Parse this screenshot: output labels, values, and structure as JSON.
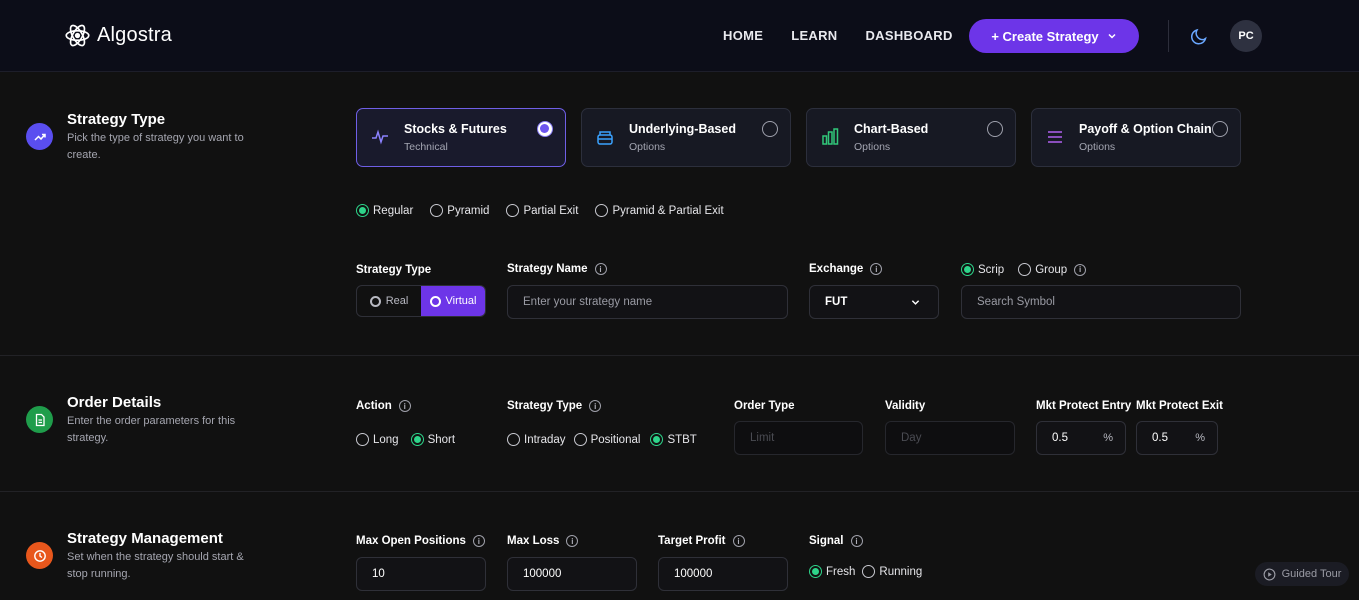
{
  "header": {
    "brand": "Algostra",
    "nav": [
      {
        "label": "HOME"
      },
      {
        "label": "LEARN"
      },
      {
        "label": "DASHBOARD"
      }
    ],
    "create_label": "+ Create Strategy",
    "avatar": "PC"
  },
  "strategy_type_section": {
    "title": "Strategy Type",
    "desc": "Pick the type of strategy you want to create.",
    "cards": [
      {
        "title": "Stocks & Futures",
        "sub": "Technical",
        "selected": true
      },
      {
        "title": "Underlying-Based",
        "sub": "Options",
        "selected": false
      },
      {
        "title": "Chart-Based",
        "sub": "Options",
        "selected": false
      },
      {
        "title": "Payoff & Option Chain",
        "sub": "Options",
        "selected": false
      }
    ],
    "modes": [
      {
        "label": "Regular",
        "selected": true
      },
      {
        "label": "Pyramid",
        "selected": false
      },
      {
        "label": "Partial Exit",
        "selected": false
      },
      {
        "label": "Pyramid & Partial Exit",
        "selected": false
      }
    ],
    "strategy_type_label": "Strategy Type",
    "toggle": {
      "real": "Real",
      "virtual": "Virtual",
      "active": "Virtual"
    },
    "strategy_name_label": "Strategy Name",
    "strategy_name_placeholder": "Enter your strategy name",
    "exchange_label": "Exchange",
    "exchange_value": "FUT",
    "scrip_label": "Scrip",
    "group_label": "Group",
    "scrip_selected": "Scrip",
    "search_placeholder": "Search Symbol"
  },
  "order_section": {
    "title": "Order Details",
    "desc": "Enter the order parameters for this strategy.",
    "action_label": "Action",
    "actions": [
      {
        "label": "Long",
        "selected": false
      },
      {
        "label": "Short",
        "selected": true
      }
    ],
    "type_label": "Strategy Type",
    "types": [
      {
        "label": "Intraday",
        "selected": false
      },
      {
        "label": "Positional",
        "selected": false
      },
      {
        "label": "STBT",
        "selected": true
      }
    ],
    "order_type_label": "Order Type",
    "order_type_placeholder": "Limit",
    "validity_label": "Validity",
    "validity_placeholder": "Day",
    "mkt_entry_label": "Mkt Protect Entry",
    "mkt_entry_value": "0.5",
    "mkt_exit_label": "Mkt Protect Exit",
    "mkt_exit_value": "0.5",
    "unit": "%"
  },
  "management_section": {
    "title": "Strategy Management",
    "desc": "Set when the strategy should start & stop running.",
    "max_open_label": "Max Open Positions",
    "max_open_value": "10",
    "max_loss_label": "Max Loss",
    "max_loss_value": "100000",
    "target_label": "Target Profit",
    "target_value": "100000",
    "signal_label": "Signal",
    "signals": [
      {
        "label": "Fresh",
        "selected": true
      },
      {
        "label": "Running",
        "selected": false
      }
    ]
  },
  "guided_tour": "Guided Tour",
  "colors": {
    "accent": "#6d35e8",
    "green": "#2ed48a",
    "bg": "#111111"
  }
}
